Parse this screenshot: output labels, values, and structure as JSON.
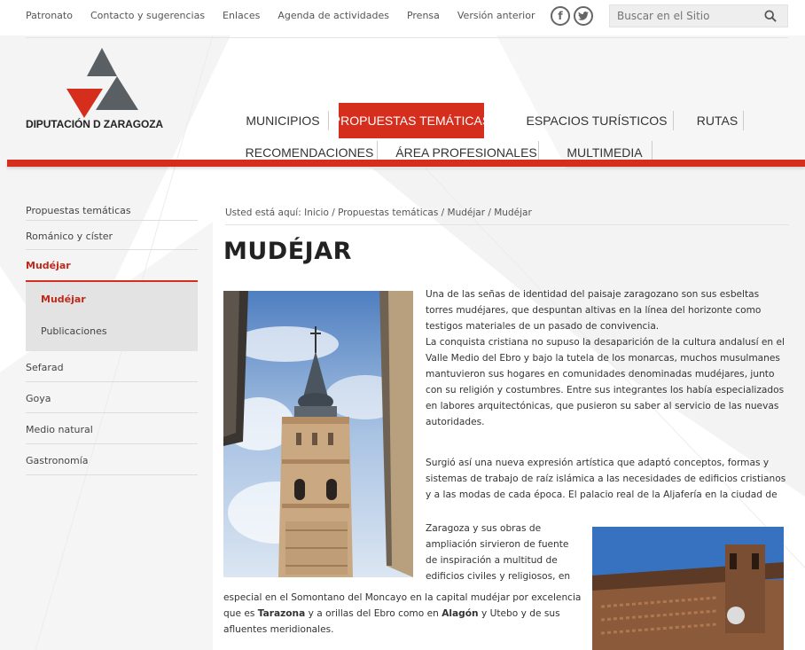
{
  "top_links": [
    "Patronato",
    "Contacto y sugerencias",
    "Enlaces",
    "Agenda de actividades",
    "Prensa",
    "Versión anterior"
  ],
  "social": {
    "facebook": "f",
    "twitter": "t"
  },
  "search": {
    "placeholder": "Buscar en el Sitio"
  },
  "logo": {
    "text": "DIPUTACIÓN D ZARAGOZA"
  },
  "nav": {
    "municipios": "MUNICIPIOS",
    "propuestas": "PROPUESTAS TEMÁTICAS",
    "espacios": "ESPACIOS TURÍSTICOS",
    "rutas": "RUTAS",
    "recomendaciones": "RECOMENDACIONES",
    "area": "ÁREA PROFESIONALES",
    "multimedia": "MULTIMEDIA"
  },
  "sidebar": {
    "propuestas": "Propuestas temáticas",
    "romanico": "Románico y císter",
    "mudejar": "Mudéjar",
    "sub_mudejar": "Mudéjar",
    "sub_publicaciones": "Publicaciones",
    "sefarad": "Sefarad",
    "goya": "Goya",
    "medio": "Medio natural",
    "gastronomia": "Gastronomía"
  },
  "breadcrumb": "Usted está aquí: Inicio / Propuestas temáticas / Mudéjar / Mudéjar",
  "title": "MUDÉJAR",
  "body": {
    "p1": "Una de las señas de identidad del paisaje zaragozano son sus esbeltas torres mudéjares, que despuntan altivas en la línea del horizonte como testigos materiales de un pasado de convivencia.",
    "p2": "La conquista cristiana no supuso la desaparición de la cultura andalusí en el Valle Medio del Ebro y bajo la tutela de los monarcas, muchos musulmanes mantuvieron sus hogares en comunidades denominadas mudéjares, junto con su religión y costumbres. Entre sus integrantes los había especializados en labores arquitectónicas, que pusieron su saber al servicio de las nuevas autoridades.",
    "p3": "Surgió así una nueva expresión artística que adaptó conceptos, formas y sistemas de trabajo de raíz islámica a las necesidades de edificios cristianos y a las modas de cada época. El palacio real de la Aljafería en la ciudad de",
    "p4": "Zaragoza y sus obras de ampliación sirvieron de fuente de inspiración a multitud de edificios civiles y religiosos, en",
    "p5_a": "especial en el Somontano del Moncayo en la capital mudéjar por excelencia que es ",
    "p5_tarazona": "Tarazona",
    "p5_b": " y a orillas del Ebro como en ",
    "p5_alagon": "Alagón",
    "p5_c": " y Utebo y de sus afluentes meridionales."
  },
  "colors": {
    "accent": "#d62e1c",
    "text": "#333333",
    "submenu_bg": "#e3e3e3",
    "logo_dark": "#5a5f63"
  }
}
